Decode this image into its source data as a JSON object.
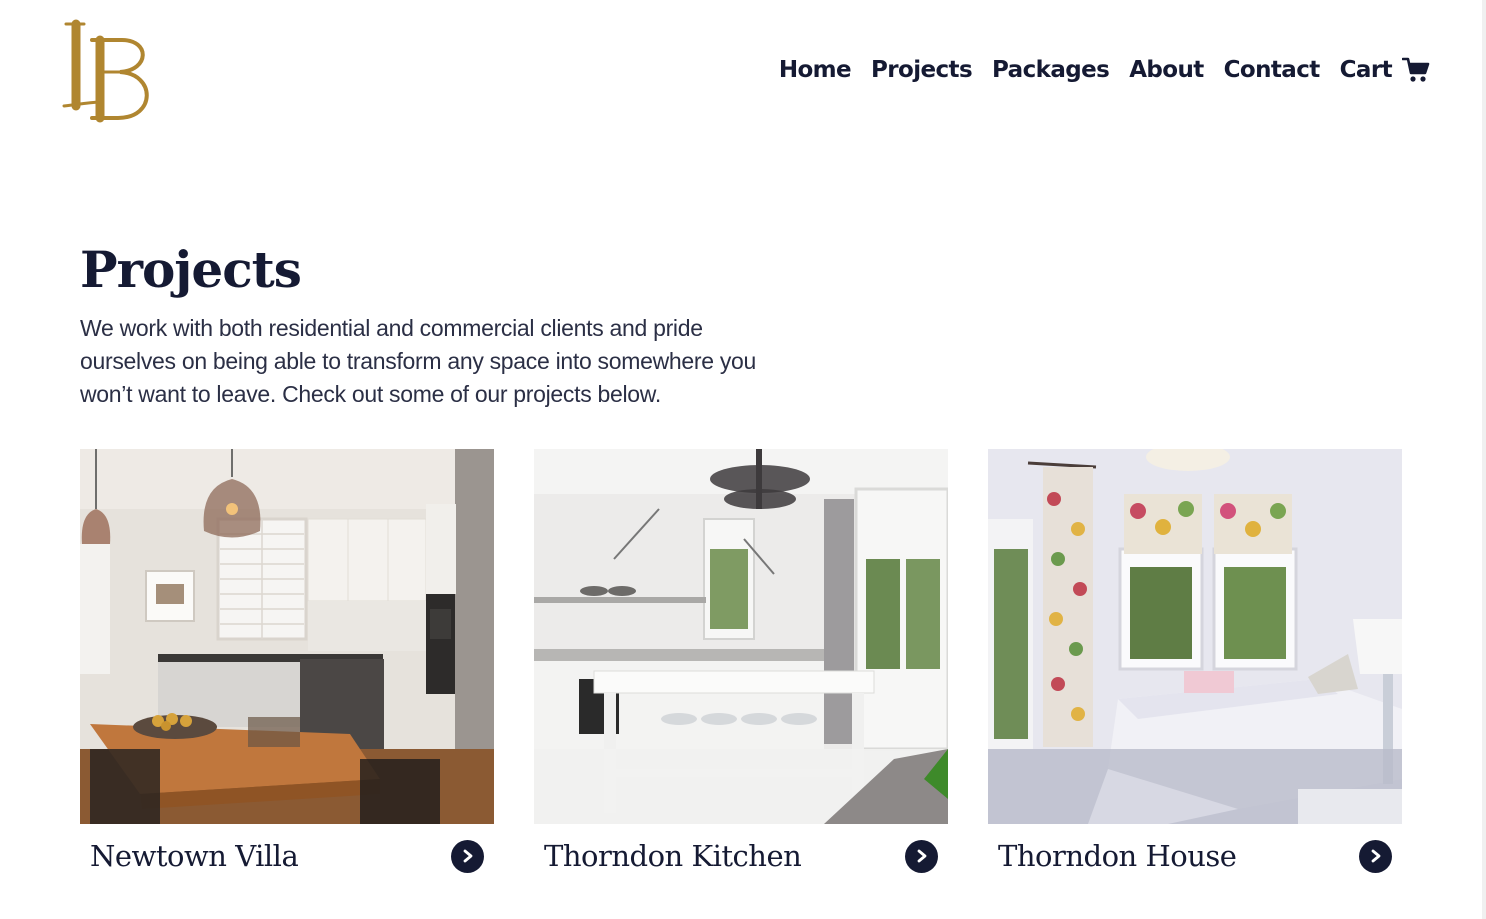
{
  "brand": {
    "logo_text": "LB",
    "color": "#b08630"
  },
  "nav": {
    "items": [
      {
        "label": "Home"
      },
      {
        "label": "Projects"
      },
      {
        "label": "Packages"
      },
      {
        "label": "About"
      },
      {
        "label": "Contact"
      }
    ],
    "cart": {
      "label": "Cart",
      "icon": "cart-icon"
    }
  },
  "page": {
    "title": "Projects",
    "intro": "We work with both residential and commercial clients and pride ourselves on being able to transform any space into somewhere you won’t want to leave. Check out some of our projects below."
  },
  "projects": [
    {
      "title": "Newtown Villa",
      "icon": "chevron-right-icon"
    },
    {
      "title": "Thorndon Kitchen",
      "icon": "chevron-right-icon"
    },
    {
      "title": "Thorndon House",
      "icon": "chevron-right-icon"
    }
  ],
  "colors": {
    "text": "#151a33",
    "accent": "#b08630",
    "background": "#ffffff"
  }
}
